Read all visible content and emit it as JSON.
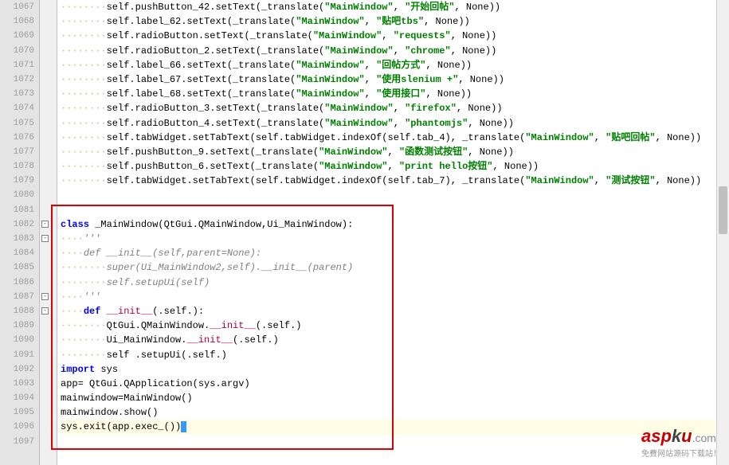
{
  "watermark": {
    "asp": "asp",
    "k": "k",
    "u": "u",
    "com": ".com",
    "sub": "免費网站源码下载站！"
  },
  "lines": [
    {
      "n": "1067",
      "ws": "········",
      "t": [
        [
          "self",
          "self"
        ],
        [
          ".pushButton_42.setText(_translate(",
          ""
        ],
        [
          "\"MainWindow\"",
          "str"
        ],
        [
          ", ",
          ""
        ],
        [
          "\"开始回帖\"",
          "str"
        ],
        [
          ", ",
          ""
        ],
        [
          "None",
          "none"
        ],
        [
          "))",
          ""
        ]
      ]
    },
    {
      "n": "1068",
      "ws": "········",
      "t": [
        [
          "self",
          "self"
        ],
        [
          ".label_62.setText(_translate(",
          ""
        ],
        [
          "\"MainWindow\"",
          "str"
        ],
        [
          ", ",
          ""
        ],
        [
          "\"贴吧tbs\"",
          "str"
        ],
        [
          ", ",
          ""
        ],
        [
          "None",
          "none"
        ],
        [
          "))",
          ""
        ]
      ]
    },
    {
      "n": "1069",
      "ws": "········",
      "t": [
        [
          "self",
          "self"
        ],
        [
          ".radioButton.setText(_translate(",
          ""
        ],
        [
          "\"MainWindow\"",
          "str"
        ],
        [
          ", ",
          ""
        ],
        [
          "\"requests\"",
          "str"
        ],
        [
          ", ",
          ""
        ],
        [
          "None",
          "none"
        ],
        [
          "))",
          ""
        ]
      ]
    },
    {
      "n": "1070",
      "ws": "········",
      "t": [
        [
          "self",
          "self"
        ],
        [
          ".radioButton_2.setText(_translate(",
          ""
        ],
        [
          "\"MainWindow\"",
          "str"
        ],
        [
          ", ",
          ""
        ],
        [
          "\"chrome\"",
          "str"
        ],
        [
          ", ",
          ""
        ],
        [
          "None",
          "none"
        ],
        [
          "))",
          ""
        ]
      ]
    },
    {
      "n": "1071",
      "ws": "········",
      "t": [
        [
          "self",
          "self"
        ],
        [
          ".label_66.setText(_translate(",
          ""
        ],
        [
          "\"MainWindow\"",
          "str"
        ],
        [
          ", ",
          ""
        ],
        [
          "\"回帖方式\"",
          "str"
        ],
        [
          ", ",
          ""
        ],
        [
          "None",
          "none"
        ],
        [
          "))",
          ""
        ]
      ]
    },
    {
      "n": "1072",
      "ws": "········",
      "t": [
        [
          "self",
          "self"
        ],
        [
          ".label_67.setText(_translate(",
          ""
        ],
        [
          "\"MainWindow\"",
          "str"
        ],
        [
          ", ",
          ""
        ],
        [
          "\"使用slenium +\"",
          "str"
        ],
        [
          ", ",
          ""
        ],
        [
          "None",
          "none"
        ],
        [
          "))",
          ""
        ]
      ]
    },
    {
      "n": "1073",
      "ws": "········",
      "t": [
        [
          "self",
          "self"
        ],
        [
          ".label_68.setText(_translate(",
          ""
        ],
        [
          "\"MainWindow\"",
          "str"
        ],
        [
          ", ",
          ""
        ],
        [
          "\"使用接口\"",
          "str"
        ],
        [
          ", ",
          ""
        ],
        [
          "None",
          "none"
        ],
        [
          "))",
          ""
        ]
      ]
    },
    {
      "n": "1074",
      "ws": "········",
      "t": [
        [
          "self",
          "self"
        ],
        [
          ".radioButton_3.setText(_translate(",
          ""
        ],
        [
          "\"MainWindow\"",
          "str"
        ],
        [
          ", ",
          ""
        ],
        [
          "\"firefox\"",
          "str"
        ],
        [
          ", ",
          ""
        ],
        [
          "None",
          "none"
        ],
        [
          "))",
          ""
        ]
      ]
    },
    {
      "n": "1075",
      "ws": "········",
      "t": [
        [
          "self",
          "self"
        ],
        [
          ".radioButton_4.setText(_translate(",
          ""
        ],
        [
          "\"MainWindow\"",
          "str"
        ],
        [
          ", ",
          ""
        ],
        [
          "\"phantomjs\"",
          "str"
        ],
        [
          ", ",
          ""
        ],
        [
          "None",
          "none"
        ],
        [
          "))",
          ""
        ]
      ]
    },
    {
      "n": "1076",
      "ws": "········",
      "t": [
        [
          "self",
          "self"
        ],
        [
          ".tabWidget.setTabText(",
          ""
        ],
        [
          "self",
          "self"
        ],
        [
          ".tabWidget.indexOf(",
          ""
        ],
        [
          "self",
          "self"
        ],
        [
          ".tab_4), _translate(",
          ""
        ],
        [
          "\"MainWindow\"",
          "str"
        ],
        [
          ", ",
          ""
        ],
        [
          "\"贴吧回帖\"",
          "str"
        ],
        [
          ", ",
          ""
        ],
        [
          "None",
          "none"
        ],
        [
          "))",
          ""
        ]
      ]
    },
    {
      "n": "1077",
      "ws": "········",
      "t": [
        [
          "self",
          "self"
        ],
        [
          ".pushButton_9.setText(_translate(",
          ""
        ],
        [
          "\"MainWindow\"",
          "str"
        ],
        [
          ", ",
          ""
        ],
        [
          "\"函数测试按钮\"",
          "str"
        ],
        [
          ", ",
          ""
        ],
        [
          "None",
          "none"
        ],
        [
          "))",
          ""
        ]
      ]
    },
    {
      "n": "1078",
      "ws": "········",
      "t": [
        [
          "self",
          "self"
        ],
        [
          ".pushButton_6.setText(_translate(",
          ""
        ],
        [
          "\"MainWindow\"",
          "str"
        ],
        [
          ", ",
          ""
        ],
        [
          "\"print hello按钮\"",
          "str"
        ],
        [
          ", ",
          ""
        ],
        [
          "None",
          "none"
        ],
        [
          "))",
          ""
        ]
      ]
    },
    {
      "n": "1079",
      "ws": "········",
      "t": [
        [
          "self",
          "self"
        ],
        [
          ".tabWidget.setTabText(",
          ""
        ],
        [
          "self",
          "self"
        ],
        [
          ".tabWidget.indexOf(",
          ""
        ],
        [
          "self",
          "self"
        ],
        [
          ".tab_7), _translate(",
          ""
        ],
        [
          "\"MainWindow\"",
          "str"
        ],
        [
          ", ",
          ""
        ],
        [
          "\"测试按钮\"",
          "str"
        ],
        [
          ", ",
          ""
        ],
        [
          "None",
          "none"
        ],
        [
          "))",
          ""
        ]
      ]
    },
    {
      "n": "1080",
      "ws": "",
      "t": []
    },
    {
      "n": "1081",
      "ws": "",
      "t": []
    },
    {
      "n": "1082",
      "ws": "",
      "t": [
        [
          "class",
          "kw"
        ],
        [
          " _MainWindow(QtGui.QMainWindow,Ui_MainWindow):",
          ""
        ]
      ]
    },
    {
      "n": "1083",
      "ws": "····",
      "t": [
        [
          "'''",
          "cmt"
        ]
      ]
    },
    {
      "n": "1084",
      "ws": "····",
      "t": [
        [
          "def __init__(self,parent=None):",
          "cmt"
        ]
      ]
    },
    {
      "n": "1085",
      "ws": "········",
      "t": [
        [
          "super(Ui_MainWindow2,self).__init__(parent)",
          "cmt"
        ]
      ]
    },
    {
      "n": "1086",
      "ws": "········",
      "t": [
        [
          "self.setupUi(self)",
          "cmt"
        ]
      ]
    },
    {
      "n": "1087",
      "ws": "····",
      "t": [
        [
          "'''",
          "cmt"
        ]
      ]
    },
    {
      "n": "1088",
      "ws": "····",
      "t": [
        [
          "def",
          "kw"
        ],
        [
          " ",
          ""
        ],
        [
          "__init__",
          "init"
        ],
        [
          "(.",
          ""
        ],
        [
          "self",
          "self"
        ],
        [
          ".):",
          ""
        ]
      ]
    },
    {
      "n": "1089",
      "ws": "········",
      "t": [
        [
          "QtGui.QMainWindow.",
          ""
        ],
        [
          "__init__",
          "init"
        ],
        [
          "(.",
          ""
        ],
        [
          "self",
          "self"
        ],
        [
          ".)",
          ""
        ]
      ]
    },
    {
      "n": "1090",
      "ws": "········",
      "t": [
        [
          "Ui_MainWindow.",
          ""
        ],
        [
          "__init__",
          "init"
        ],
        [
          "(.",
          ""
        ],
        [
          "self",
          "self"
        ],
        [
          ".)",
          ""
        ]
      ]
    },
    {
      "n": "1091",
      "ws": "········",
      "t": [
        [
          "self",
          "self"
        ],
        [
          " .setupUi(.",
          ""
        ],
        [
          "self",
          "self"
        ],
        [
          ".)",
          ""
        ]
      ]
    },
    {
      "n": "1092",
      "ws": "",
      "t": [
        [
          "import",
          "kw"
        ],
        [
          " sys",
          ""
        ]
      ]
    },
    {
      "n": "1093",
      "ws": "",
      "t": [
        [
          "app= QtGui.QApplication(sys.argv)",
          ""
        ]
      ]
    },
    {
      "n": "1094",
      "ws": "",
      "t": [
        [
          "mainwindow=MainWindow()",
          ""
        ]
      ]
    },
    {
      "n": "1095",
      "ws": "",
      "t": [
        [
          "mainwindow.show()",
          ""
        ]
      ]
    },
    {
      "n": "1096",
      "ws": "",
      "hl": true,
      "sel": true,
      "t": [
        [
          "sys.exit",
          ""
        ],
        [
          "(",
          "paren"
        ],
        [
          "app.exec_()",
          ""
        ],
        [
          ")",
          "paren"
        ]
      ]
    },
    {
      "n": "1097",
      "ws": "",
      "t": []
    }
  ],
  "fold_marks": [
    {
      "line": 15,
      "sym": "-"
    },
    {
      "line": 16,
      "sym": "-"
    },
    {
      "line": 20,
      "sym": "-"
    },
    {
      "line": 21,
      "sym": "-"
    }
  ]
}
